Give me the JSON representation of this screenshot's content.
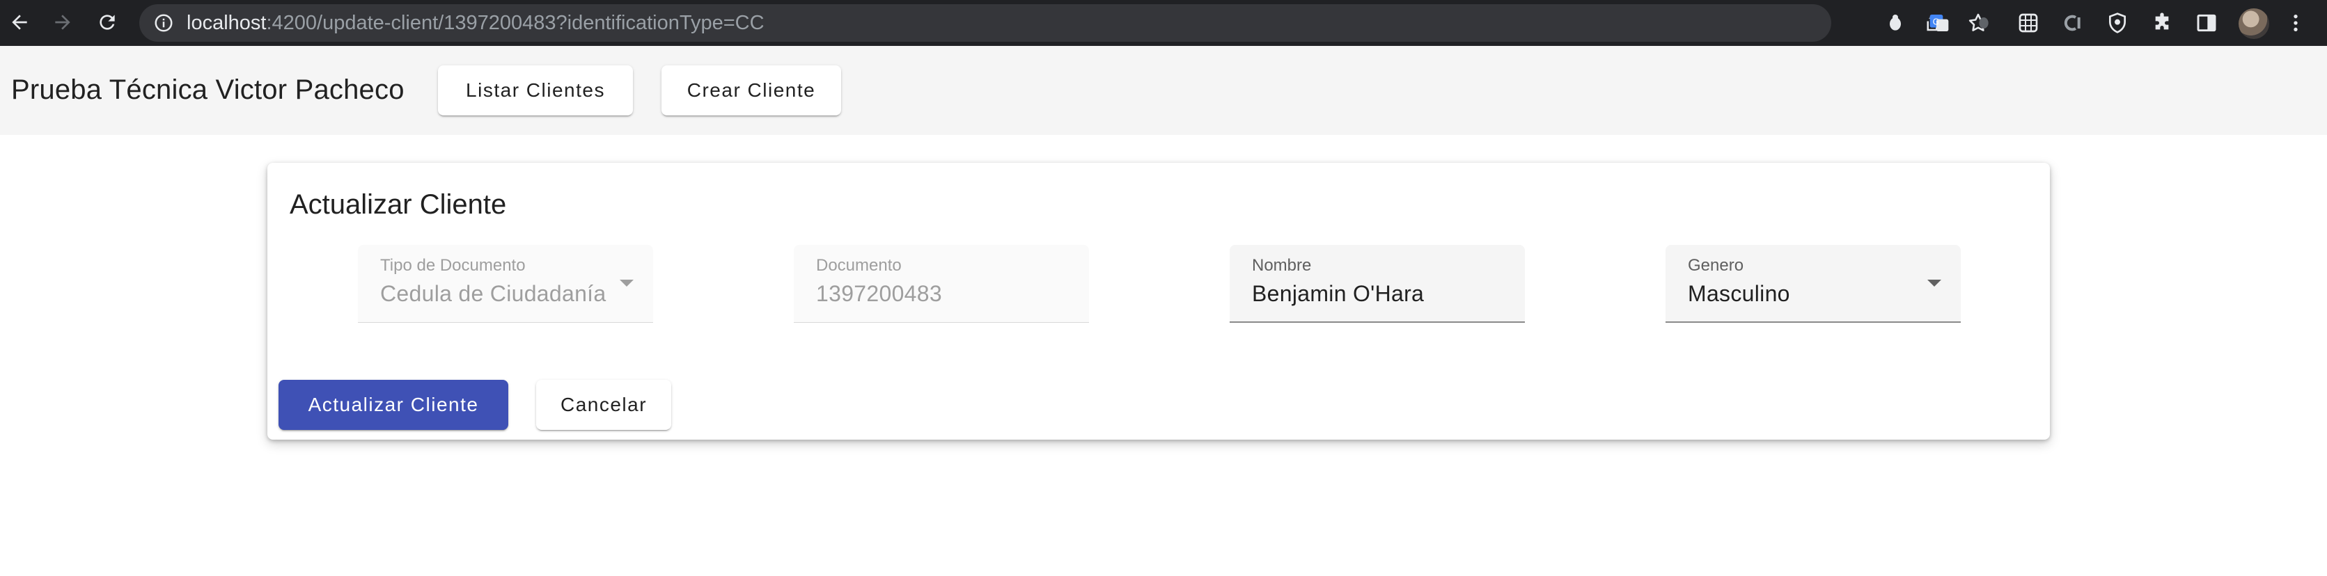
{
  "browser": {
    "url_host": "localhost",
    "url_rest": ":4200/update-client/1397200483?identificationType=CC"
  },
  "toolbar": {
    "title": "Prueba Técnica Victor Pacheco",
    "list_button": "Listar Clientes",
    "create_button": "Crear Cliente"
  },
  "card": {
    "title": "Actualizar Cliente",
    "fields": {
      "document_type": {
        "label": "Tipo de Documento",
        "value": "Cedula de Ciudadanía",
        "disabled": true
      },
      "document": {
        "label": "Documento",
        "value": "1397200483",
        "disabled": true
      },
      "name": {
        "label": "Nombre",
        "value": "Benjamin O'Hara"
      },
      "gender": {
        "label": "Genero",
        "value": "Masculino"
      }
    },
    "update_button": "Actualizar Cliente",
    "cancel_button": "Cancelar"
  },
  "colors": {
    "primary": "#3f51b5",
    "toolbar_bg": "#f5f5f5",
    "chrome_bg": "#202124"
  }
}
